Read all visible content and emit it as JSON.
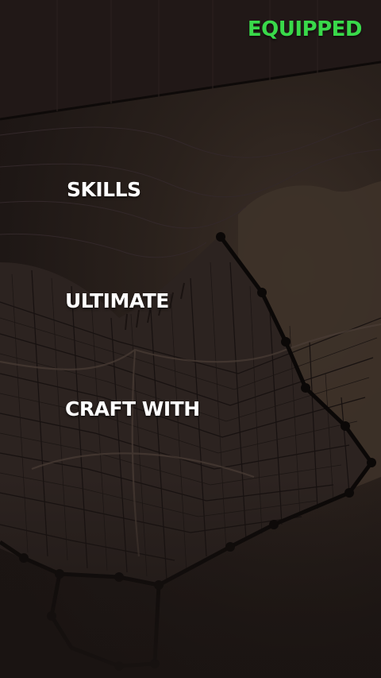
{
  "header": {
    "status_label": "EQUIPPED"
  },
  "menu": {
    "items": [
      {
        "label": "SKILLS"
      },
      {
        "label": "ULTIMATE"
      },
      {
        "label": "CRAFT WITH"
      }
    ]
  },
  "colors": {
    "status": "#39d94a",
    "label": "#ffffff",
    "background": "#241c18"
  }
}
